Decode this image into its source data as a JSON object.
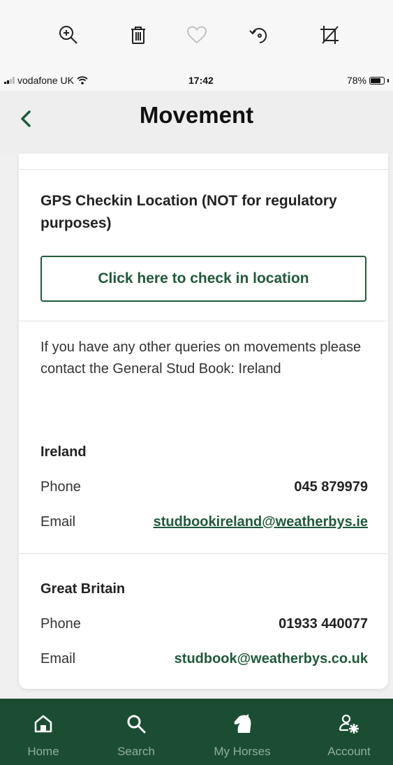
{
  "toolbar": {
    "icons": [
      "zoom-in-icon",
      "trash-icon",
      "heart-icon",
      "rotate-icon",
      "crop-icon"
    ]
  },
  "status_bar": {
    "carrier": "vodafone UK",
    "time": "17:42",
    "battery": "78%",
    "battery_level": 0.78
  },
  "header": {
    "title": "Movement",
    "back_icon": "chevron-left-icon"
  },
  "gps": {
    "title": "GPS Checkin Location (NOT for regulatory purposes)",
    "button_label": "Click here to check in location"
  },
  "contact": {
    "intro": "If you have any other queries on movements please contact the General Stud Book: Ireland",
    "ireland": {
      "title": "Ireland",
      "phone_label": "Phone",
      "phone": "045 879979",
      "email_label": "Email",
      "email": "studbookireland@weatherbys.ie"
    },
    "great_britain": {
      "title": "Great Britain",
      "phone_label": "Phone",
      "phone": "01933 440077",
      "email_label": "Email",
      "email": "studbook@weatherbys.co.uk"
    }
  },
  "nav": {
    "items": [
      {
        "label": "Home",
        "icon": "home-icon"
      },
      {
        "label": "Search",
        "icon": "search-icon"
      },
      {
        "label": "My Horses",
        "icon": "horse-head-icon"
      },
      {
        "label": "Account",
        "icon": "account-settings-icon"
      }
    ]
  },
  "colors": {
    "brand_green": "#1f5a3b",
    "nav_background": "#1b4d33",
    "nav_label": "#8fb09c"
  }
}
